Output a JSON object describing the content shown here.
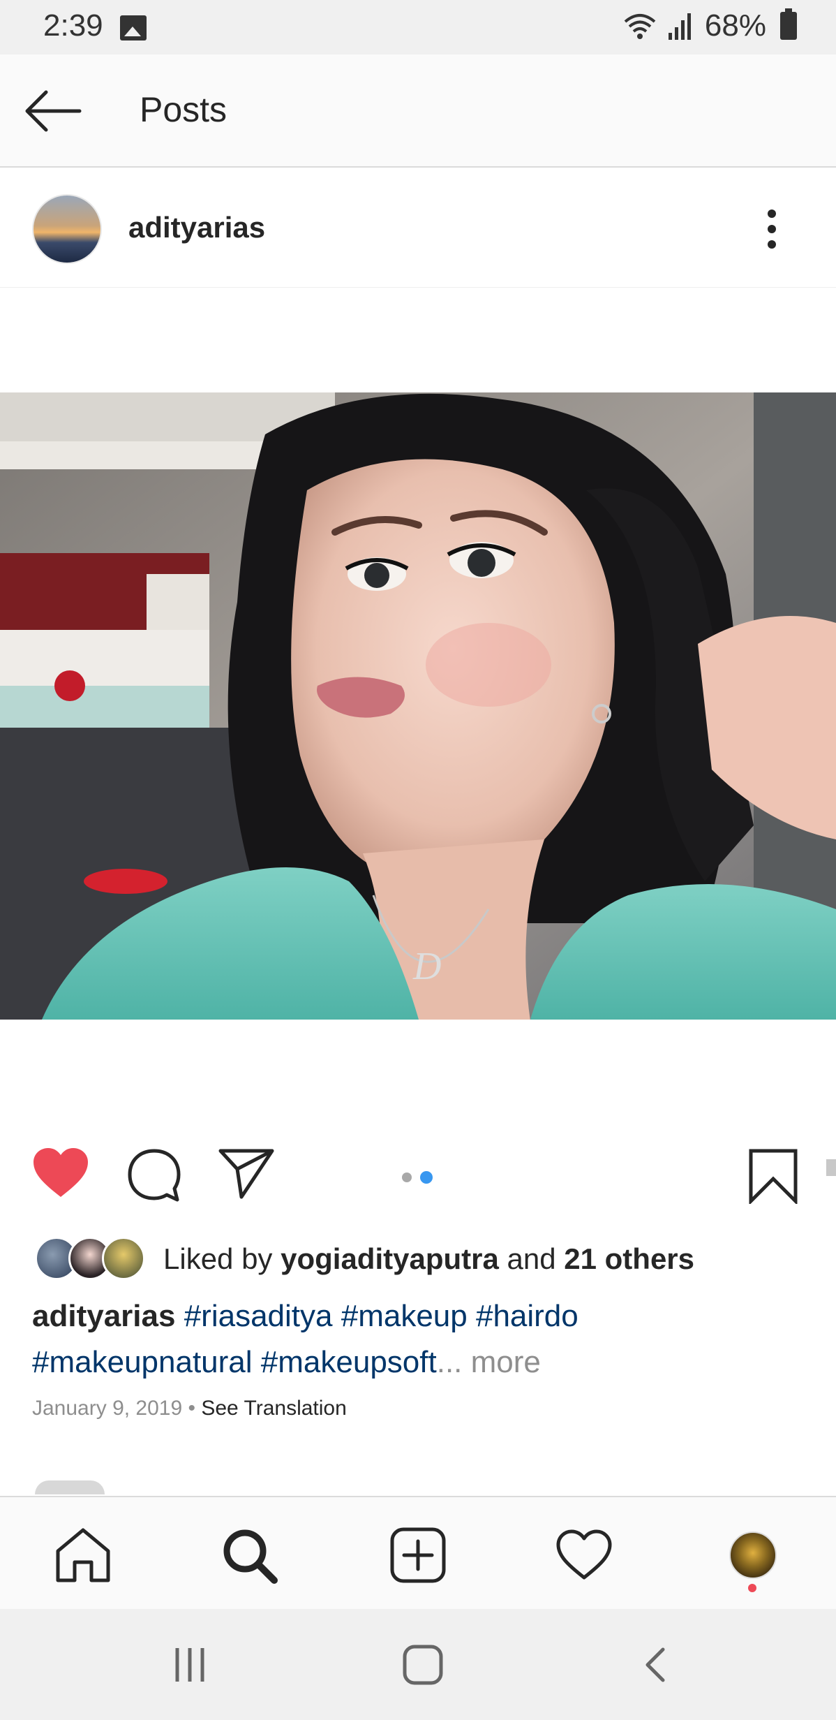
{
  "status_bar": {
    "time": "2:39",
    "battery": "68%",
    "icons": [
      "gallery-icon",
      "wifi-icon",
      "signal-icon",
      "battery-icon"
    ]
  },
  "header": {
    "title": "Posts",
    "back_icon": "arrow-left-icon"
  },
  "post": {
    "username": "adityarias",
    "more_icon": "more-vertical-icon",
    "carousel": {
      "count": 2,
      "active_index": 1
    },
    "liked": true,
    "likes": {
      "prefix": "Liked by ",
      "user": "yogiadityaputra",
      "middle": " and ",
      "others": "21 others"
    },
    "caption": {
      "user": "adityarias",
      "line1_tags": [
        "#riasaditya",
        "#makeup",
        "#hairdo"
      ],
      "line2_tags": [
        "#makeupnatural",
        "#makeupsoft"
      ],
      "ellipsis": "...",
      "more": "more"
    },
    "date": "January 9, 2019",
    "separator": " • ",
    "see_translation": "See Translation"
  },
  "colors": {
    "heart_red": "#ed4956",
    "active_dot_blue": "#3897f0",
    "hashtag_blue": "#003569",
    "muted_gray": "#8e8e8e"
  }
}
